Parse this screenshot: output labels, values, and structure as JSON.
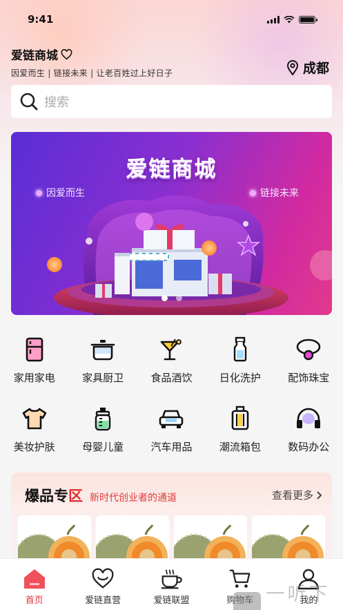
{
  "status_bar": {
    "time": "9:41"
  },
  "header": {
    "brand_name": "爱链商城",
    "tagline": "因爱而生 | 链接未来 | 让老百姓过上好日子",
    "city": "成都"
  },
  "search": {
    "placeholder": "搜索"
  },
  "banner": {
    "title": "爱链商城",
    "left_text": "因爱而生",
    "right_text": "链接未来",
    "page_count": 2,
    "active_page": 1
  },
  "categories": [
    {
      "label": "家用家电",
      "icon": "fridge-icon"
    },
    {
      "label": "家具厨卫",
      "icon": "pot-icon"
    },
    {
      "label": "食品酒饮",
      "icon": "cocktail-icon"
    },
    {
      "label": "日化洗护",
      "icon": "bottle-icon"
    },
    {
      "label": "配饰珠宝",
      "icon": "ring-icon"
    },
    {
      "label": "美妆护肤",
      "icon": "tshirt-icon"
    },
    {
      "label": "母婴儿童",
      "icon": "baby-bottle-icon"
    },
    {
      "label": "汽车用品",
      "icon": "car-icon"
    },
    {
      "label": "潮流箱包",
      "icon": "suitcase-icon"
    },
    {
      "label": "数码办公",
      "icon": "headphones-icon"
    }
  ],
  "hot_zone": {
    "title_normal": "爆品专",
    "title_accent": "区",
    "subtitle": "新时代创业者的通道",
    "more_label": "查看更多"
  },
  "tabbar": [
    {
      "label": "首页",
      "icon": "home-icon",
      "active": true
    },
    {
      "label": "爱链直营",
      "icon": "heart-icon",
      "active": false
    },
    {
      "label": "爱链联盟",
      "icon": "coffee-cup-icon",
      "active": false
    },
    {
      "label": "购物车",
      "icon": "cart-icon",
      "active": false
    },
    {
      "label": "我的",
      "icon": "user-icon",
      "active": false
    }
  ],
  "watermark": {
    "text": "一听下载"
  },
  "colors": {
    "accent": "#e3323d",
    "banner_start": "#5a2dd6",
    "banner_end": "#e13a8c"
  }
}
